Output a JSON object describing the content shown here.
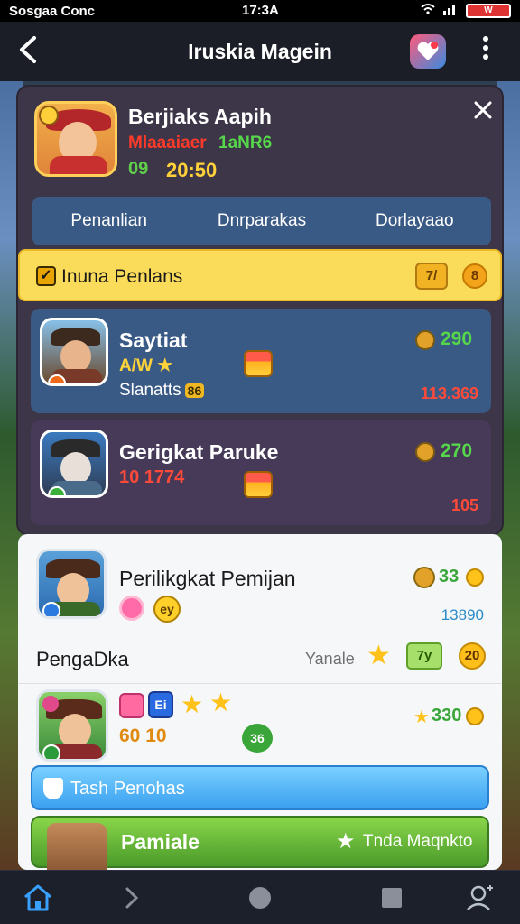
{
  "status_bar": {
    "left": "Sosgaa  Conc",
    "time": "17:3A",
    "battery": "W"
  },
  "header": {
    "title": "Iruskia Magein"
  },
  "profile": {
    "name": "Berjiaks Aapih",
    "subtitle_red": "Mlaaaiaer",
    "subtitle_green": "1aNR6",
    "id": "09",
    "time": "20:50"
  },
  "tabs": [
    "Penanlian",
    "Dnrparakas",
    "Dorlayaao"
  ],
  "banner": {
    "text": "Inuna Penlans",
    "chip": "7/",
    "coin": "8"
  },
  "players": [
    {
      "name": "Saytiat",
      "stars": "A/W ★",
      "sub": "Slanatts",
      "sub_badge": "86",
      "score": "290",
      "red_score": "113.369"
    },
    {
      "name": "Gerigkat Paruke",
      "red_value": "10 1774",
      "score": "270",
      "red_score": "105"
    }
  ],
  "light_panel": {
    "row1": {
      "name": "Perilikgkat Pemijan",
      "yellow_icon": "ey",
      "score": "33",
      "number": "13890"
    },
    "row2": {
      "label": "PengaDka",
      "variable": "Yanale",
      "star": "★",
      "chip": "7y",
      "coin": "20"
    },
    "row3": {
      "blue_icon": "Ei",
      "nums": "60 10",
      "green_badge": "36",
      "score": "330"
    },
    "blue_bar": {
      "text": "Tash Penohas"
    },
    "green_bar": {
      "title": "Pamiale",
      "text": "Tnda Maqnkto"
    }
  },
  "colors": {
    "header_bg": "#1b1e26",
    "panel_bg": "#3d3648",
    "tabs_bg": "#3a5a86",
    "banner_bg": "#fbdc5a",
    "score_green": "#56d64a",
    "accent_red": "#ff4a3a",
    "light_panel_bg": "#f6f7f9"
  },
  "icons": {
    "back": "chevron-left-icon",
    "heart": "heart-badge-icon",
    "more": "more-vertical-icon",
    "close": "close-icon",
    "nav_home": "home-icon",
    "nav_back": "chevron-right-icon",
    "nav_circle": "circle-icon",
    "nav_square": "square-icon",
    "nav_user": "user-icon"
  }
}
